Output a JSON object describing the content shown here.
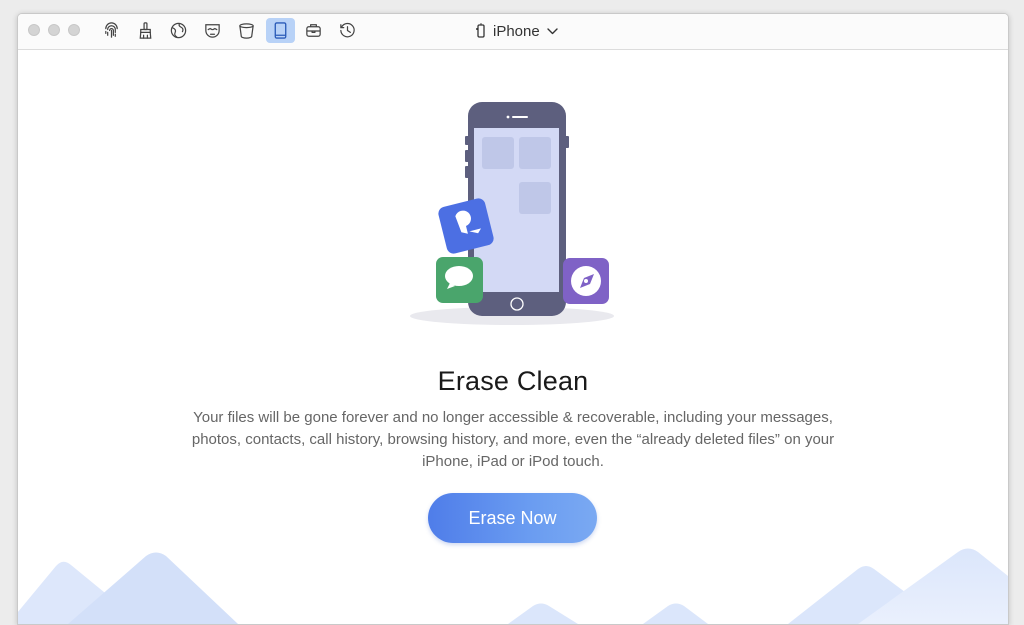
{
  "toolbar": {
    "icons": [
      "fingerprint-icon",
      "cleaner-brush-icon",
      "globe-icon",
      "privacy-mask-icon",
      "trash-bin-icon",
      "tablet-icon",
      "toolbox-icon",
      "history-icon"
    ],
    "active": "tablet-icon"
  },
  "device": {
    "name": "iPhone",
    "icon": "phone-icon"
  },
  "main": {
    "title": "Erase Clean",
    "description": "Your files will be gone forever and no longer accessible & recoverable, including your messages, photos, contacts, call history, browsing history, and more, even the “already deleted files” on your iPhone, iPad or iPod touch.",
    "button_label": "Erase Now"
  },
  "colors": {
    "accent": "#5b8aee",
    "active_tool": "#b8d2f7",
    "phone_body": "#5d5f7e",
    "phone_screen": "#d3d9f5",
    "messages_app": "#4aa56c",
    "contacts_app": "#4c6fe3",
    "safari_app": "#7f62c6"
  }
}
